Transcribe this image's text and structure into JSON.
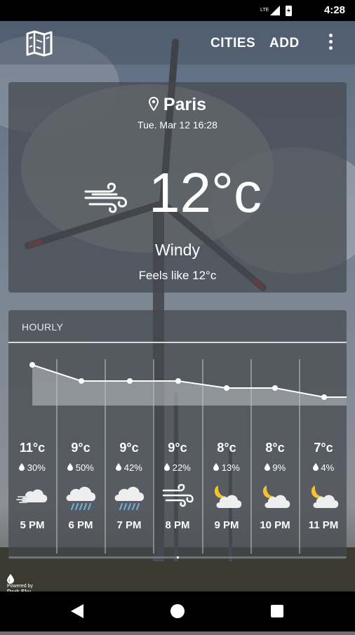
{
  "status_bar": {
    "time": "4:28",
    "network": "LTE"
  },
  "app_bar": {
    "logo_icon": "map-book-icon",
    "cities_label": "CITIES",
    "add_label": "ADD",
    "menu_icon": "more-vert-icon"
  },
  "current": {
    "city": "Paris",
    "datetime": "Tue. Mar 12 16:28",
    "temperature": "12°c",
    "condition": "Windy",
    "feels_like": "Feels like 12°c",
    "icon": "wind-icon"
  },
  "hourly": {
    "title": "HOURLY",
    "items": [
      {
        "time": "5 PM",
        "temp": "11°c",
        "precip": "30%",
        "icon": "cloud-wind-icon"
      },
      {
        "time": "6 PM",
        "temp": "9°c",
        "precip": "50%",
        "icon": "rain-cloud-icon"
      },
      {
        "time": "7 PM",
        "temp": "9°c",
        "precip": "42%",
        "icon": "rain-cloud-icon"
      },
      {
        "time": "8 PM",
        "temp": "9°c",
        "precip": "22%",
        "icon": "wind-icon"
      },
      {
        "time": "9 PM",
        "temp": "8°c",
        "precip": "13%",
        "icon": "moon-cloud-icon"
      },
      {
        "time": "10 PM",
        "temp": "8°c",
        "precip": "9%",
        "icon": "moon-cloud-icon"
      },
      {
        "time": "11 PM",
        "temp": "7°c",
        "precip": "4%",
        "icon": "moon-cloud-icon"
      }
    ]
  },
  "powered_by": {
    "line1": "Powered by",
    "line2": "Dark Sky"
  }
}
